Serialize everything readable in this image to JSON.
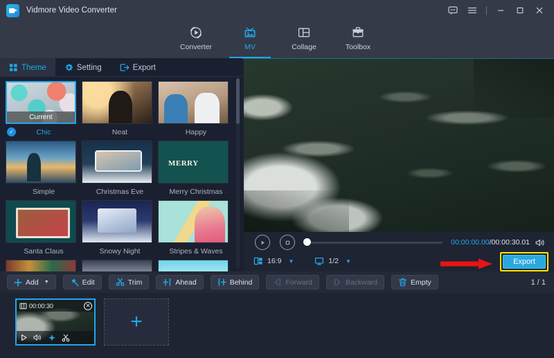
{
  "window": {
    "title": "Vidmore Video Converter",
    "controls": [
      {
        "name": "feedback-icon",
        "glyph": "feedback"
      },
      {
        "name": "menu-icon",
        "glyph": "menu"
      },
      {
        "name": "minimize-icon",
        "glyph": "minimize"
      },
      {
        "name": "maximize-icon",
        "glyph": "maximize"
      },
      {
        "name": "close-icon",
        "glyph": "close"
      }
    ]
  },
  "nav": {
    "items": [
      {
        "label": "Converter",
        "icon": "converter-icon",
        "active": false
      },
      {
        "label": "MV",
        "icon": "mv-icon",
        "active": true
      },
      {
        "label": "Collage",
        "icon": "collage-icon",
        "active": false
      },
      {
        "label": "Toolbox",
        "icon": "toolbox-icon",
        "active": false
      }
    ],
    "active_color": "#22a7e8"
  },
  "tabs": {
    "items": [
      {
        "label": "Theme",
        "icon": "grid-icon",
        "active": true
      },
      {
        "label": "Setting",
        "icon": "gear-icon",
        "active": false
      },
      {
        "label": "Export",
        "icon": "export-icon",
        "active": false
      }
    ]
  },
  "themes": {
    "current_badge": "Current",
    "items": [
      {
        "label": "Chic",
        "art": "a-chic",
        "selected": true
      },
      {
        "label": "Neat",
        "art": "a-neat",
        "selected": false
      },
      {
        "label": "Happy",
        "art": "a-happy",
        "selected": false
      },
      {
        "label": "Simple",
        "art": "a-simple",
        "selected": false
      },
      {
        "label": "Christmas Eve",
        "art": "a-xmaseve",
        "selected": false
      },
      {
        "label": "Merry Christmas",
        "art": "a-merry",
        "selected": false
      },
      {
        "label": "Santa Claus",
        "art": "a-santa",
        "selected": false
      },
      {
        "label": "Snowy Night",
        "art": "a-snowy",
        "selected": false
      },
      {
        "label": "Stripes & Waves",
        "art": "a-stripes",
        "selected": false
      }
    ]
  },
  "player": {
    "play_icon": "play-icon",
    "stop_icon": "stop-icon",
    "progress_percent": 0,
    "current_time": "00:00:00.00",
    "time_separator": "/",
    "total_time": "00:00:30.01",
    "volume_icon": "volume-icon",
    "aspect_icon": "aspect-ratio-icon",
    "aspect_value": "16:9",
    "screen_icon": "screen-icon",
    "screen_value": "1/2",
    "export_label": "Export",
    "export_color": "#29a8e0",
    "highlight_color": "#ffe500",
    "annotation_arrow_color": "#e81414"
  },
  "toolbar": {
    "buttons": [
      {
        "label": "Add",
        "icon": "plus-icon",
        "dropdown": true,
        "disabled": false
      },
      {
        "label": "Edit",
        "icon": "edit-magic-icon",
        "dropdown": false,
        "disabled": false
      },
      {
        "label": "Trim",
        "icon": "scissors-icon",
        "dropdown": false,
        "disabled": false
      },
      {
        "label": "Ahead",
        "icon": "insert-ahead-icon",
        "dropdown": false,
        "disabled": false
      },
      {
        "label": "Behind",
        "icon": "insert-behind-icon",
        "dropdown": false,
        "disabled": false
      },
      {
        "label": "Forward",
        "icon": "move-forward-icon",
        "dropdown": false,
        "disabled": true
      },
      {
        "label": "Backward",
        "icon": "move-backward-icon",
        "dropdown": false,
        "disabled": true
      },
      {
        "label": "Empty",
        "icon": "trash-icon",
        "dropdown": false,
        "disabled": false
      }
    ],
    "page_indicator": "1 / 1"
  },
  "timeline": {
    "clip": {
      "duration": "00:00:30",
      "film_icon": "film-icon",
      "close_icon": "close-icon",
      "actions": [
        {
          "name": "play-icon"
        },
        {
          "name": "volume-icon"
        },
        {
          "name": "effect-star-icon"
        },
        {
          "name": "scissors-icon"
        }
      ]
    },
    "add_slot_icon": "plus-icon"
  }
}
